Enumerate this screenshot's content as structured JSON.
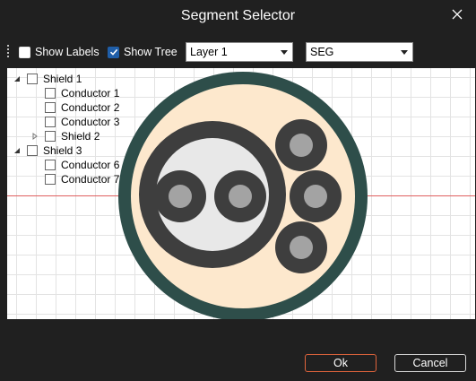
{
  "window": {
    "title": "Segment Selector"
  },
  "toolbar": {
    "show_labels": {
      "label": "Show Labels",
      "checked": false
    },
    "show_tree": {
      "label": "Show Tree",
      "checked": true
    },
    "layer_select": {
      "value": "Layer 1"
    },
    "type_select": {
      "value": "SEG"
    }
  },
  "tree": [
    {
      "label": "Shield 1",
      "depth": 0,
      "expander": "expanded"
    },
    {
      "label": "Conductor 1",
      "depth": 1,
      "expander": "none"
    },
    {
      "label": "Conductor 2",
      "depth": 1,
      "expander": "none"
    },
    {
      "label": "Conductor 3",
      "depth": 1,
      "expander": "none"
    },
    {
      "label": "Shield 2",
      "depth": 1,
      "expander": "collapsed"
    },
    {
      "label": "Shield 3",
      "depth": 0,
      "expander": "expanded"
    },
    {
      "label": "Conductor 6",
      "depth": 1,
      "expander": "none"
    },
    {
      "label": "Conductor 7",
      "depth": 1,
      "expander": "none"
    }
  ],
  "colors": {
    "outer_jacket": "#2e4e4a",
    "fill": "#fde8cd",
    "shield_ring": "#3e3e3e",
    "inner_fill": "#e8e8e8",
    "conductor_core": "#a3a3a3",
    "reference_line": "#e06060",
    "ok_accent": "#e0643c"
  },
  "buttons": {
    "ok": "Ok",
    "cancel": "Cancel"
  }
}
